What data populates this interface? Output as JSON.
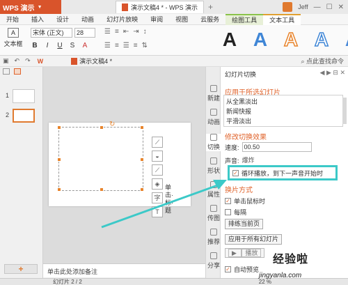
{
  "titlebar": {
    "app_name": "WPS 演示",
    "doc_tab": "演示文稿4 * - WPS 演示",
    "user": "Jeff"
  },
  "menu": [
    "开始",
    "插入",
    "设计",
    "动画",
    "幻灯片放映",
    "审阅",
    "视图",
    "云服务",
    "绘图工具",
    "文本工具"
  ],
  "ribbon": {
    "textbox_label": "文本框",
    "font": "宋体 (正文)",
    "size": "28",
    "wordart": [
      "A",
      "A",
      "A",
      "A",
      "A"
    ]
  },
  "subbar": {
    "doc_title": "演示文稿4 *",
    "add_cmd": "点此查找命令"
  },
  "thumbnails": [
    {
      "num": "1"
    },
    {
      "num": "2"
    }
  ],
  "editor": {
    "edge_text": "单击·标·题",
    "notes": "单击此处添加备注"
  },
  "sidetabs": [
    "新建",
    "动画",
    "切换",
    "形状",
    "属性",
    "传图",
    "推荐",
    "分享"
  ],
  "taskpane": {
    "title": "幻灯片切换",
    "section_apply": "应用于所选幻灯片",
    "effects": [
      "从全黑淡出",
      "新闻快报",
      "平滑淡出"
    ],
    "section_modify": "修改切换效果",
    "speed_label": "速度:",
    "speed_value": "00.50",
    "sound_label": "声音:",
    "sound_value": "爆炸",
    "loop_label": "循环播放，到下一声音开始时",
    "section_advance": "换片方式",
    "on_click": "单击鼠标时",
    "every": "每隔",
    "apply_current": "排练当前页",
    "apply_all": "应用于所有幻灯片",
    "play": "播放",
    "auto_preview": "自动预览"
  },
  "statusbar": {
    "slide_count": "幻灯片 2 / 2",
    "zoom": "22 %"
  },
  "watermark": {
    "text": "经验啦",
    "url": "jingyanla.com"
  }
}
